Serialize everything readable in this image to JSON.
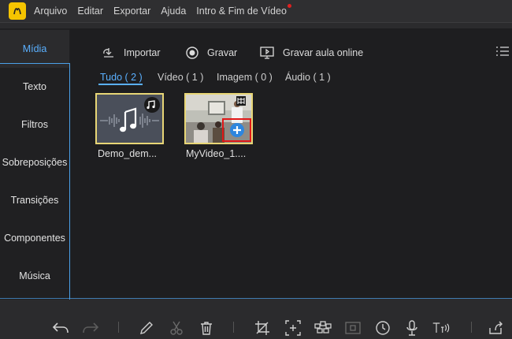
{
  "menu": {
    "items": [
      "Arquivo",
      "Editar",
      "Exportar",
      "Ajuda",
      "Intro & Fim de Vídeo"
    ]
  },
  "sidebar": {
    "items": [
      {
        "label": "Mídia"
      },
      {
        "label": "Texto"
      },
      {
        "label": "Filtros"
      },
      {
        "label": "Sobreposições"
      },
      {
        "label": "Transições"
      },
      {
        "label": "Componentes"
      },
      {
        "label": "Música"
      }
    ]
  },
  "toolbar": {
    "import_label": "Importar",
    "record_label": "Gravar",
    "record_online_label": "Gravar aula online"
  },
  "filters": {
    "all": "Tudo ( 2 )",
    "video": "Vídeo ( 1 )",
    "image": "Imagem ( 0 )",
    "audio": "Áudio ( 1 )"
  },
  "media": {
    "items": [
      {
        "name": "Demo_dem...",
        "type": "audio"
      },
      {
        "name": "MyVideo_1....",
        "type": "video"
      }
    ]
  },
  "colors": {
    "accent": "#4aa0e8",
    "logo": "#f5c400",
    "add_button": "#2e86de",
    "highlight_box": "#e01818"
  }
}
